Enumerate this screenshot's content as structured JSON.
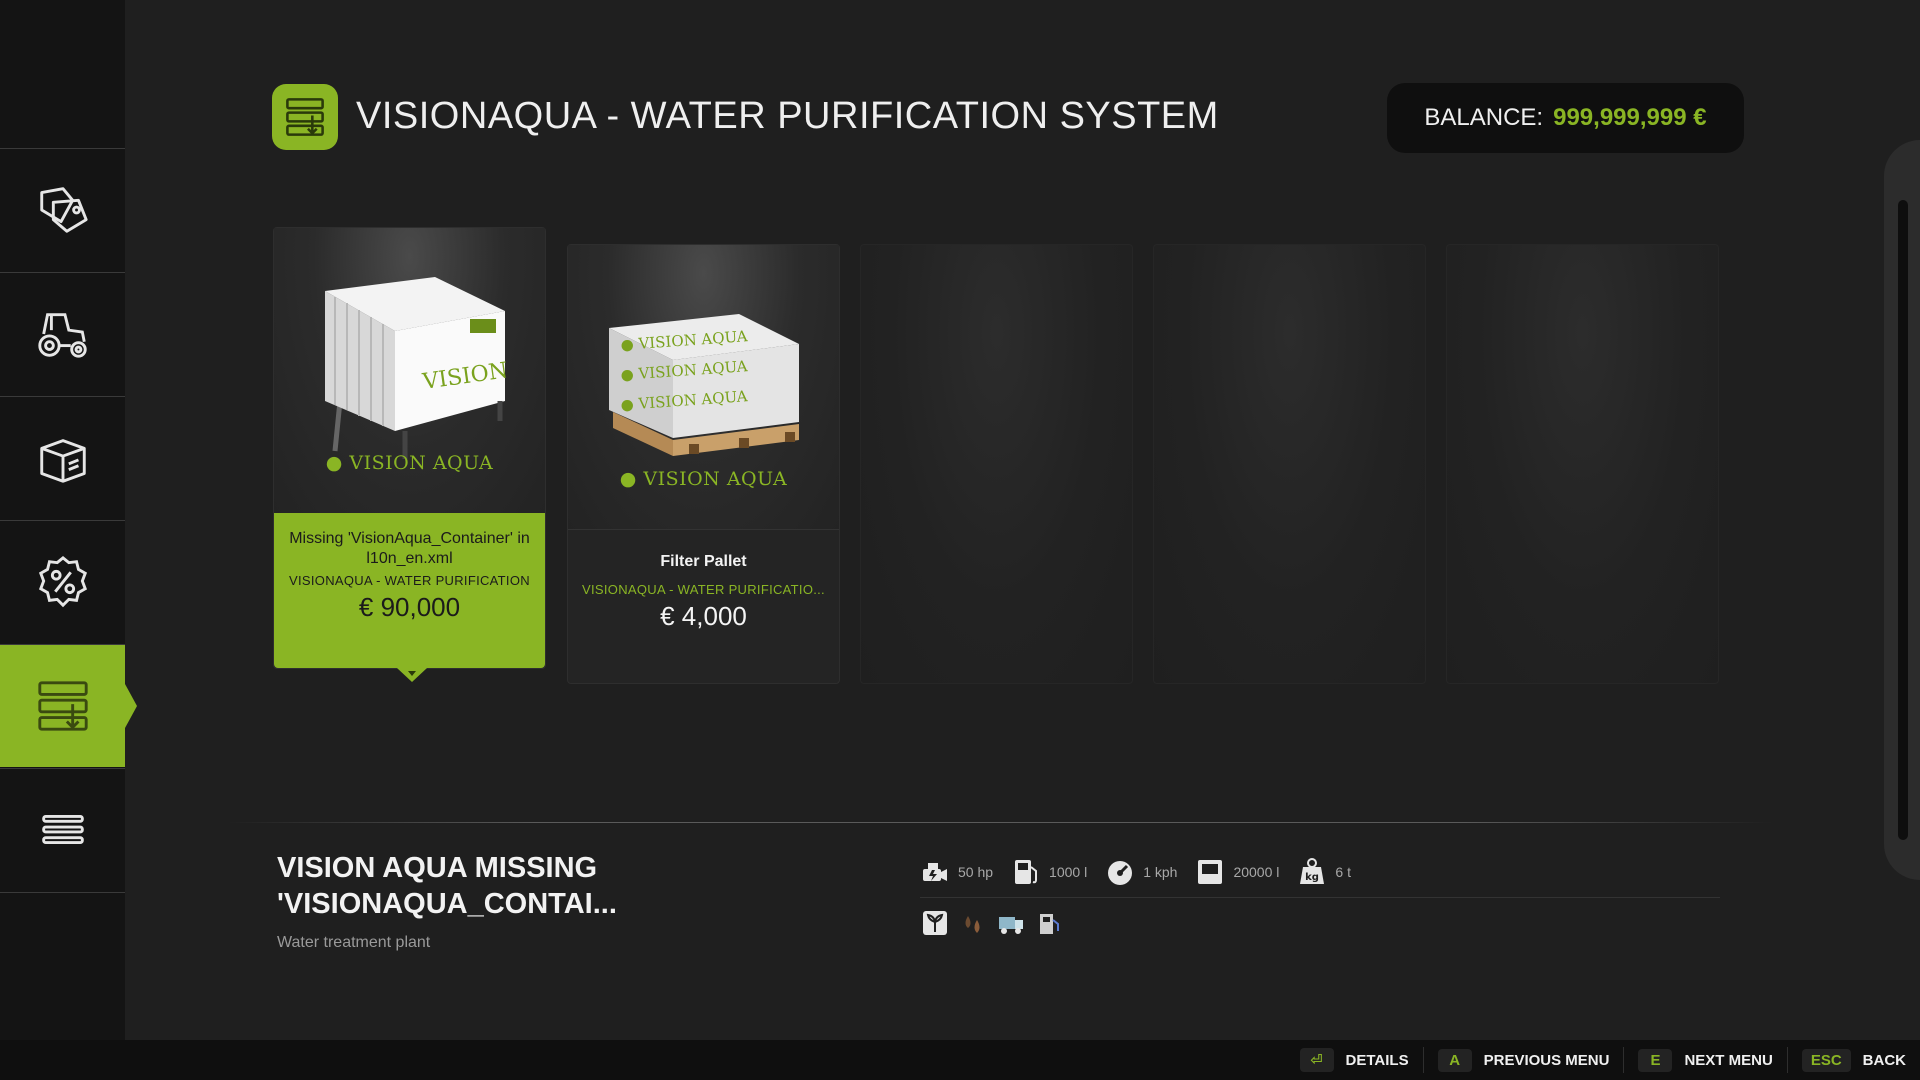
{
  "header": {
    "title": "VISIONAQUA - WATER PURIFICATION SYSTEM",
    "balance_label": "BALANCE:",
    "balance_value": "999,999,999 €",
    "icon": "production-storage-icon"
  },
  "sidebar": {
    "items": [
      {
        "name": "sales-tag-icon",
        "active": false
      },
      {
        "name": "tractor-icon",
        "active": false
      },
      {
        "name": "box-icon",
        "active": false
      },
      {
        "name": "percent-icon",
        "active": false
      },
      {
        "name": "production-storage-icon",
        "active": true
      },
      {
        "name": "list-menu-icon",
        "active": false
      }
    ]
  },
  "cards": [
    {
      "name": "Missing 'VisionAqua_Container' in l10n_en.xml",
      "brand": "VISION AQUA",
      "category": "VISIONAQUA - WATER PURIFICATION",
      "price": "€ 90,000",
      "selected": true
    },
    {
      "name": "Filter Pallet",
      "brand": "VISION AQUA",
      "category": "VISIONAQUA - WATER PURIFICATIO...",
      "price": "€ 4,000",
      "selected": false
    }
  ],
  "details": {
    "title": "VISION AQUA MISSING 'VISIONAQUA_CONTAI...",
    "description": "Water treatment plant",
    "specs": [
      {
        "icon": "power-icon",
        "value": "50 hp"
      },
      {
        "icon": "fuel-icon",
        "value": "1000 l"
      },
      {
        "icon": "speedometer-icon",
        "value": "1 kph"
      },
      {
        "icon": "capacity-icon",
        "value": "20000 l"
      },
      {
        "icon": "weight-icon",
        "value": "6 t"
      }
    ],
    "fill_types": [
      "plant-growth-icon",
      "water-drops-icon",
      "truck-icon",
      "fuel-station-icon"
    ]
  },
  "footer": {
    "hints": [
      {
        "key": "⏎",
        "label": "DETAILS"
      },
      {
        "key": "A",
        "label": "PREVIOUS MENU"
      },
      {
        "key": "E",
        "label": "NEXT MENU"
      },
      {
        "key": "ESC",
        "label": "BACK"
      }
    ]
  },
  "colors": {
    "accent": "#8ab524",
    "background": "#1f1f1f",
    "sidebar": "#141414"
  }
}
